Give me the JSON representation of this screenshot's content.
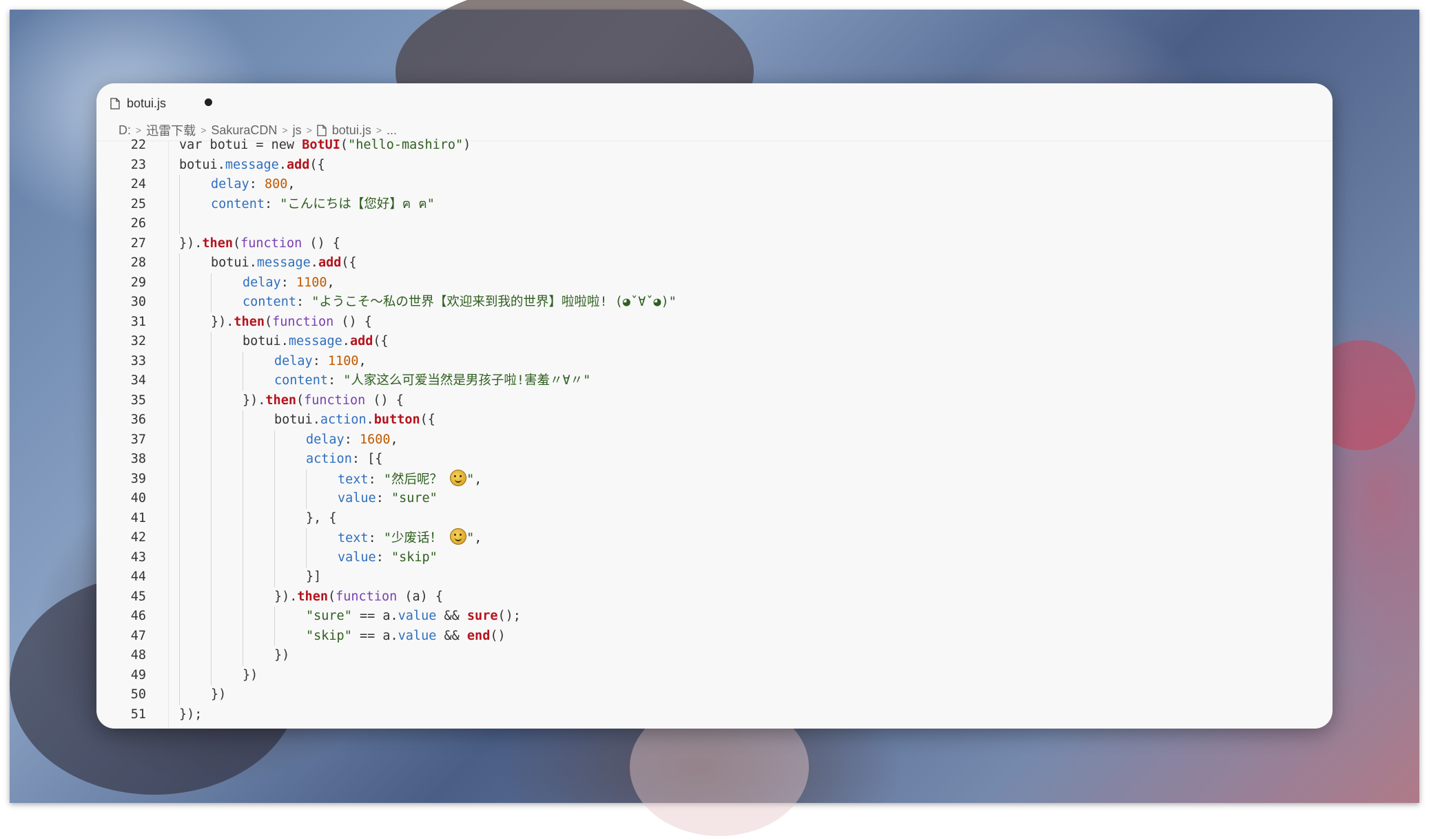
{
  "tab": {
    "label": "botui.js",
    "modified": true
  },
  "breadcrumb": [
    "D:",
    "迅雷下载",
    "SakuraCDN",
    "js",
    "botui.js",
    "..."
  ],
  "icons": {
    "file": "file-icon",
    "separator": "chevron-right-icon",
    "modified": "unsaved-dot-icon",
    "emoji_smile": "smiling-face-icon",
    "emoji_neutral": "neutral-face-icon"
  },
  "colors": {
    "keyword": "#7a3fb4",
    "property": "#2f6fbf",
    "method": "#b5131d",
    "number": "#c05a00",
    "string": "#2f5f1f"
  },
  "code": {
    "lines": [
      {
        "num": "22",
        "indent": 1,
        "tokens": [
          [
            "t",
            "var botui = new "
          ],
          [
            "m",
            "BotUI"
          ],
          [
            "t",
            "("
          ],
          [
            "s",
            "\"hello-mashiro\""
          ],
          [
            "t",
            ")"
          ]
        ]
      },
      {
        "num": "23",
        "indent": 1,
        "tokens": [
          [
            "t",
            "botui."
          ],
          [
            "p",
            "message"
          ],
          [
            "t",
            "."
          ],
          [
            "m",
            "add"
          ],
          [
            "t",
            "({"
          ]
        ]
      },
      {
        "num": "24",
        "indent": 2,
        "tokens": [
          [
            "p",
            "delay"
          ],
          [
            "t",
            ": "
          ],
          [
            "n",
            "800"
          ],
          [
            "t",
            ","
          ]
        ]
      },
      {
        "num": "25",
        "indent": 2,
        "tokens": [
          [
            "p",
            "content"
          ],
          [
            "t",
            ": "
          ],
          [
            "s",
            "\"こんにちは【您好】ฅ ฅ\""
          ]
        ]
      },
      {
        "num": "26",
        "indent": 2,
        "tokens": []
      },
      {
        "num": "27",
        "indent": 1,
        "tokens": [
          [
            "t",
            "})."
          ],
          [
            "m",
            "then"
          ],
          [
            "t",
            "("
          ],
          [
            "k",
            "function"
          ],
          [
            "t",
            " () {"
          ]
        ]
      },
      {
        "num": "28",
        "indent": 2,
        "tokens": [
          [
            "t",
            "botui."
          ],
          [
            "p",
            "message"
          ],
          [
            "t",
            "."
          ],
          [
            "m",
            "add"
          ],
          [
            "t",
            "({"
          ]
        ]
      },
      {
        "num": "29",
        "indent": 3,
        "tokens": [
          [
            "p",
            "delay"
          ],
          [
            "t",
            ": "
          ],
          [
            "n",
            "1100"
          ],
          [
            "t",
            ","
          ]
        ]
      },
      {
        "num": "30",
        "indent": 3,
        "tokens": [
          [
            "p",
            "content"
          ],
          [
            "t",
            ": "
          ],
          [
            "s",
            "\"ようこそ～私の世界【欢迎来到我的世界】啦啦啦! (◕ˇ∀ˇ◕)\""
          ]
        ]
      },
      {
        "num": "31",
        "indent": 2,
        "tokens": [
          [
            "t",
            "})."
          ],
          [
            "m",
            "then"
          ],
          [
            "t",
            "("
          ],
          [
            "k",
            "function"
          ],
          [
            "t",
            " () {"
          ]
        ]
      },
      {
        "num": "32",
        "indent": 3,
        "tokens": [
          [
            "t",
            "botui."
          ],
          [
            "p",
            "message"
          ],
          [
            "t",
            "."
          ],
          [
            "m",
            "add"
          ],
          [
            "t",
            "({"
          ]
        ]
      },
      {
        "num": "33",
        "indent": 4,
        "tokens": [
          [
            "p",
            "delay"
          ],
          [
            "t",
            ": "
          ],
          [
            "n",
            "1100"
          ],
          [
            "t",
            ","
          ]
        ]
      },
      {
        "num": "34",
        "indent": 4,
        "tokens": [
          [
            "p",
            "content"
          ],
          [
            "t",
            ": "
          ],
          [
            "s",
            "\"人家这么可爱当然是男孩子啦!害羞〃∀〃\""
          ]
        ]
      },
      {
        "num": "35",
        "indent": 3,
        "tokens": [
          [
            "t",
            "})."
          ],
          [
            "m",
            "then"
          ],
          [
            "t",
            "("
          ],
          [
            "k",
            "function"
          ],
          [
            "t",
            " () {"
          ]
        ]
      },
      {
        "num": "36",
        "indent": 4,
        "tokens": [
          [
            "t",
            "botui."
          ],
          [
            "p",
            "action"
          ],
          [
            "t",
            "."
          ],
          [
            "m",
            "button"
          ],
          [
            "t",
            "({"
          ]
        ]
      },
      {
        "num": "37",
        "indent": 5,
        "tokens": [
          [
            "p",
            "delay"
          ],
          [
            "t",
            ": "
          ],
          [
            "n",
            "1600"
          ],
          [
            "t",
            ","
          ]
        ]
      },
      {
        "num": "38",
        "indent": 5,
        "tokens": [
          [
            "p",
            "action"
          ],
          [
            "t",
            ": [{"
          ]
        ]
      },
      {
        "num": "39",
        "indent": 6,
        "tokens": [
          [
            "p",
            "text"
          ],
          [
            "t",
            ": "
          ],
          [
            "s",
            "\"然后呢？ "
          ],
          [
            "e",
            "smile"
          ],
          [
            "s",
            "\""
          ],
          [
            "t",
            ","
          ]
        ]
      },
      {
        "num": "40",
        "indent": 6,
        "tokens": [
          [
            "p",
            "value"
          ],
          [
            "t",
            ": "
          ],
          [
            "s",
            "\"sure\""
          ]
        ]
      },
      {
        "num": "41",
        "indent": 5,
        "tokens": [
          [
            "t",
            "}, {"
          ]
        ]
      },
      {
        "num": "42",
        "indent": 6,
        "tokens": [
          [
            "p",
            "text"
          ],
          [
            "t",
            ": "
          ],
          [
            "s",
            "\"少废话！ "
          ],
          [
            "e",
            "neutral"
          ],
          [
            "s",
            "\""
          ],
          [
            "t",
            ","
          ]
        ]
      },
      {
        "num": "43",
        "indent": 6,
        "tokens": [
          [
            "p",
            "value"
          ],
          [
            "t",
            ": "
          ],
          [
            "s",
            "\"skip\""
          ]
        ]
      },
      {
        "num": "44",
        "indent": 5,
        "tokens": [
          [
            "t",
            "}]"
          ]
        ]
      },
      {
        "num": "45",
        "indent": 4,
        "tokens": [
          [
            "t",
            "})."
          ],
          [
            "m",
            "then"
          ],
          [
            "t",
            "("
          ],
          [
            "k",
            "function"
          ],
          [
            "t",
            " (a) {"
          ]
        ]
      },
      {
        "num": "46",
        "indent": 5,
        "tokens": [
          [
            "s",
            "\"sure\""
          ],
          [
            "t",
            " == a."
          ],
          [
            "p",
            "value"
          ],
          [
            "t",
            " && "
          ],
          [
            "m",
            "sure"
          ],
          [
            "t",
            "();"
          ]
        ]
      },
      {
        "num": "47",
        "indent": 5,
        "tokens": [
          [
            "s",
            "\"skip\""
          ],
          [
            "t",
            " == a."
          ],
          [
            "p",
            "value"
          ],
          [
            "t",
            " && "
          ],
          [
            "m",
            "end"
          ],
          [
            "t",
            "()"
          ]
        ]
      },
      {
        "num": "48",
        "indent": 4,
        "tokens": [
          [
            "t",
            "})"
          ]
        ]
      },
      {
        "num": "49",
        "indent": 3,
        "tokens": [
          [
            "t",
            "})"
          ]
        ]
      },
      {
        "num": "50",
        "indent": 2,
        "tokens": [
          [
            "t",
            "})"
          ]
        ]
      },
      {
        "num": "51",
        "indent": 1,
        "tokens": [
          [
            "t",
            "});"
          ]
        ]
      }
    ]
  }
}
